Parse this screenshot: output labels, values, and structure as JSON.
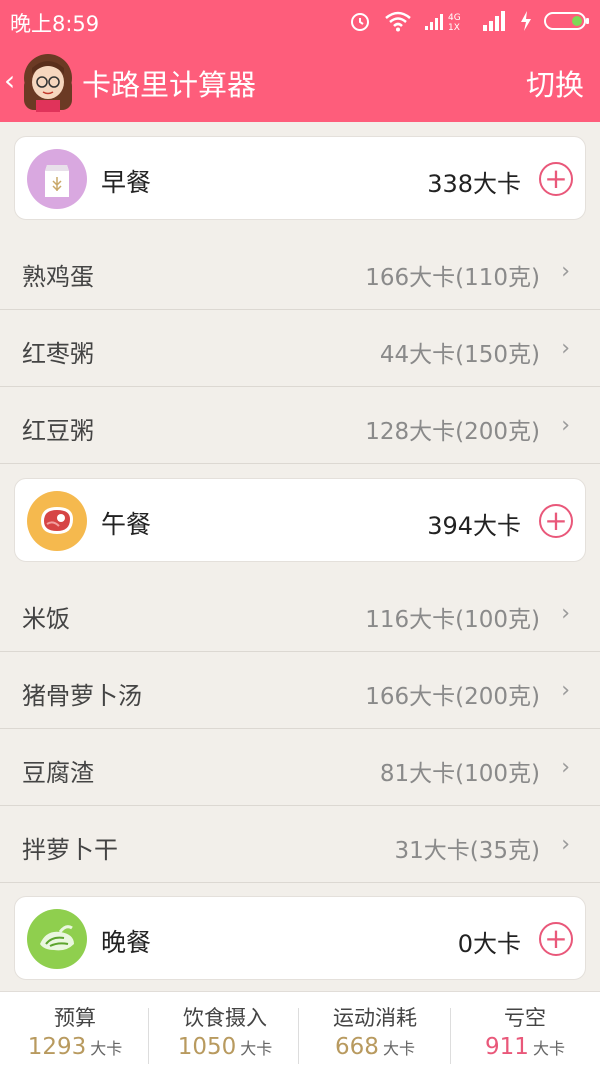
{
  "status": {
    "time": "晚上8:59",
    "network": "4G 1X"
  },
  "header": {
    "title": "卡路里计算器",
    "switch_label": "切换"
  },
  "meals": [
    {
      "name": "早餐",
      "kcal": "338大卡",
      "items": [
        {
          "name": "熟鸡蛋",
          "value": "166大卡(110克)"
        },
        {
          "name": "红枣粥",
          "value": "44大卡(150克)"
        },
        {
          "name": "红豆粥",
          "value": "128大卡(200克)"
        }
      ]
    },
    {
      "name": "午餐",
      "kcal": "394大卡",
      "items": [
        {
          "name": "米饭",
          "value": "116大卡(100克)"
        },
        {
          "name": "猪骨萝卜汤",
          "value": "166大卡(200克)"
        },
        {
          "name": "豆腐渣",
          "value": "81大卡(100克)"
        },
        {
          "name": "拌萝卜干",
          "value": "31大卡(35克)"
        }
      ]
    },
    {
      "name": "晚餐",
      "kcal": "0大卡",
      "items": []
    }
  ],
  "summary": [
    {
      "label": "预算",
      "value": "1293",
      "unit": "大卡",
      "color": "#b89a5f"
    },
    {
      "label": "饮食摄入",
      "value": "1050",
      "unit": "大卡",
      "color": "#b89a5f"
    },
    {
      "label": "运动消耗",
      "value": "668",
      "unit": "大卡",
      "color": "#b89a5f"
    },
    {
      "label": "亏空",
      "value": "911",
      "unit": "大卡",
      "color": "#e9587a"
    }
  ],
  "colors": {
    "accent": "#fe5d7b"
  }
}
